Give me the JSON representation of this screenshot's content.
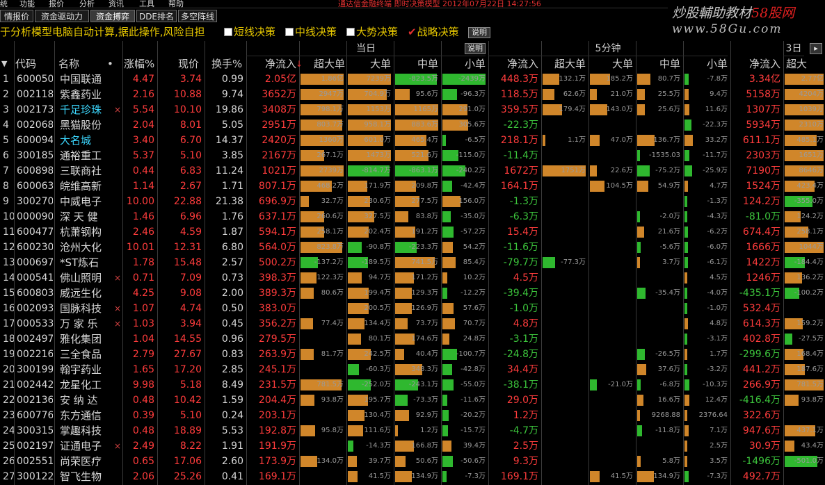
{
  "menu": {
    "items": [
      "统",
      "功能",
      "报价",
      "分析",
      "资讯",
      "工具",
      "帮助"
    ],
    "title": "通达信金融终端   即时决策模型 2012年07月22日 14:27:56"
  },
  "tabs": [
    {
      "label": "情报价",
      "active": false
    },
    {
      "label": "资金驱动力",
      "active": false
    },
    {
      "label": "资金搏弈",
      "active": true
    },
    {
      "label": "DDE排名",
      "active": false
    },
    {
      "label": "多空阵线",
      "active": false
    }
  ],
  "logo": {
    "line1_a": "炒股輔助教材",
    "line1_b": "58股网",
    "line2": "www.58Gu.com"
  },
  "description": "于分析模型电脑自动计算,据此操作,风险自担",
  "decisions": [
    {
      "label": "短线决策",
      "checked": false
    },
    {
      "label": "中线决策",
      "checked": false
    },
    {
      "label": "大势决策",
      "checked": false
    },
    {
      "label": "战略决策",
      "checked": true
    }
  ],
  "explain_label": "说明",
  "groups": {
    "today": "当日",
    "five_min": "5分钟",
    "three_day": "3日",
    "explain": "说明"
  },
  "columns": {
    "code": "代码",
    "name": "名称",
    "dot": "•",
    "change": "涨幅%",
    "price": "现价",
    "turnover": "换手%",
    "net": "净流入",
    "xl": "超大单",
    "l": "大单",
    "m": "中单",
    "s": "小单",
    "net5": "净流入",
    "xl5": "超大单",
    "l5": "大单",
    "m5": "中单",
    "s5": "小单",
    "net3": "净流入",
    "xl3": "超大"
  },
  "colors": {
    "red": "#ff3c3c",
    "green": "#3cc43c",
    "cyan": "#3cd8ff",
    "yellow": "#e6c700",
    "orange": "#d0862a",
    "greenbar": "#2fb82f"
  },
  "rows": [
    {
      "no": "1",
      "code": "600050",
      "name": "中国联通",
      "mark": "",
      "change": "4.47",
      "price": "3.74",
      "turnover": "0.99",
      "net": "2.05亿",
      "today": [
        "1.86亿",
        "7239万",
        "-823.5万",
        "-2439万"
      ],
      "net5": "448.3万",
      "five": [
        "132.1万",
        "185.2万",
        "80.7万",
        "-7.8万"
      ],
      "net3": "3.34亿",
      "d3": "2.77亿"
    },
    {
      "no": "2",
      "code": "002118",
      "name": "紫鑫药业",
      "mark": "",
      "change": "2.16",
      "price": "10.88",
      "turnover": "9.74",
      "net": "3652万",
      "today": [
        "2947万",
        "704.9万",
        "95.6万",
        "-96.3万"
      ],
      "net5": "118.5万",
      "five": [
        "62.6万",
        "21.0万",
        "25.5万",
        "9.4万"
      ],
      "net3": "5158万",
      "d3": "4204万"
    },
    {
      "no": "3",
      "code": "002173",
      "name": "千足珍珠",
      "mark": "×",
      "change": "5.54",
      "price": "10.10",
      "turnover": "19.86",
      "net": "3408万",
      "today": [
        "798.1万",
        "1153万",
        "1165万",
        "291.0万"
      ],
      "net5": "359.5万",
      "five": [
        "179.4万",
        "143.0万",
        "25.6万",
        "11.6万"
      ],
      "net3": "1307万",
      "d3": "1039万"
    },
    {
      "no": "4",
      "code": "002068",
      "name": "黑猫股份",
      "mark": "",
      "change": "2.04",
      "price": "8.01",
      "turnover": "5.05",
      "net": "2951万",
      "today": [
        "803.7万",
        "958.1万",
        "883.6万",
        "305.6万"
      ],
      "net5": "-22.3万",
      "five": [
        "",
        "",
        "",
        "-22.3万"
      ],
      "net3": "5934万",
      "d3": "2310万"
    },
    {
      "no": "5",
      "code": "600094",
      "name": "大名城",
      "mark": "",
      "change": "3.40",
      "price": "6.70",
      "turnover": "14.37",
      "net": "2420万",
      "today": [
        "1360万",
        "601.0万",
        "465.4万",
        "-6.5万"
      ],
      "net5": "218.1万",
      "five": [
        "1.1万",
        "47.0万",
        "136.7万",
        "33.2万"
      ],
      "net3": "611.1万",
      "d3": "485.1万"
    },
    {
      "no": "6",
      "code": "300185",
      "name": "通裕重工",
      "mark": "",
      "change": "5.37",
      "price": "5.10",
      "turnover": "3.85",
      "net": "2167万",
      "today": [
        "267.1万",
        "1473万",
        "521.6万",
        "-115.0万"
      ],
      "net5": "-11.4万",
      "five": [
        "",
        "",
        "-1535.03",
        "-11.7万"
      ],
      "net3": "2303万",
      "d3": "1651万"
    },
    {
      "no": "7",
      "code": "600898",
      "name": "三联商社",
      "mark": "",
      "change": "0.44",
      "price": "6.83",
      "turnover": "11.24",
      "net": "1021万",
      "today": [
        "2739万",
        "-814.7万",
        "-863.1万",
        "-240.2万"
      ],
      "net5": "1672万",
      "five": [
        "1751万",
        "22.6万",
        "-75.2万",
        "-25.9万"
      ],
      "net3": "7190万",
      "d3": "8646万"
    },
    {
      "no": "8",
      "code": "600063",
      "name": "皖维高新",
      "mark": "",
      "change": "1.14",
      "price": "2.67",
      "turnover": "1.71",
      "net": "807.1万",
      "today": [
        "468.2万",
        "171.9万",
        "209.8万",
        "-42.4万"
      ],
      "net5": "164.1万",
      "five": [
        "",
        "104.5万",
        "54.9万",
        "4.7万"
      ],
      "net3": "1524万",
      "d3": "423.4万"
    },
    {
      "no": "9",
      "code": "300270",
      "name": "中威电子",
      "mark": "",
      "change": "10.00",
      "price": "22.88",
      "turnover": "21.38",
      "net": "696.9万",
      "today": [
        "32.7万",
        "230.6万",
        "277.5万",
        "156.0万"
      ],
      "net5": "-1.3万",
      "five": [
        "",
        "",
        "",
        "-1.3万"
      ],
      "net3": "124.2万",
      "d3": "-355.0万"
    },
    {
      "no": "10",
      "code": "000090",
      "name": "深 天 健",
      "mark": "",
      "change": "1.46",
      "price": "6.96",
      "turnover": "1.76",
      "net": "637.1万",
      "today": [
        "260.6万",
        "327.5万",
        "83.8万",
        "-35.0万"
      ],
      "net5": "-6.3万",
      "five": [
        "",
        "",
        "-2.0万",
        "-4.3万"
      ],
      "net3": "-81.0万",
      "d3": "124.2万"
    },
    {
      "no": "11",
      "code": "600477",
      "name": "杭萧钢构",
      "mark": "",
      "change": "2.46",
      "price": "4.59",
      "turnover": "1.87",
      "net": "594.1万",
      "today": [
        "258.1万",
        "202.4万",
        "191.2万",
        "-57.2万"
      ],
      "net5": "15.4万",
      "five": [
        "",
        "",
        "21.6万",
        "-6.2万"
      ],
      "net3": "674.4万",
      "d3": "258.1万"
    },
    {
      "no": "12",
      "code": "600230",
      "name": "沧州大化",
      "mark": "",
      "change": "10.01",
      "price": "12.31",
      "turnover": "6.80",
      "net": "564.0万",
      "today": [
        "823.8万",
        "-90.8万",
        "-223.3万",
        "54.2万"
      ],
      "net5": "-11.6万",
      "five": [
        "",
        "",
        "-5.6万",
        "-6.0万"
      ],
      "net3": "1666万",
      "d3": "1044万"
    },
    {
      "no": "13",
      "code": "000697",
      "name": "*ST炼石",
      "mark": "",
      "change": "1.78",
      "price": "15.48",
      "turnover": "2.57",
      "net": "500.2万",
      "today": [
        "-137.2万",
        "-189.5万",
        "741.5万",
        "85.4万"
      ],
      "net5": "-79.7万",
      "five": [
        "-77.3万",
        "",
        "3.7万",
        "-6.1万"
      ],
      "net3": "1422万",
      "d3": "-184.4万"
    },
    {
      "no": "14",
      "code": "000541",
      "name": "佛山照明",
      "mark": "×",
      "change": "0.71",
      "price": "7.09",
      "turnover": "0.73",
      "net": "398.3万",
      "today": [
        "122.3万",
        "94.7万",
        "171.2万",
        "10.2万"
      ],
      "net5": "4.5万",
      "five": [
        "",
        "",
        "",
        "4.5万"
      ],
      "net3": "1246万",
      "d3": "136.2万"
    },
    {
      "no": "15",
      "code": "600803",
      "name": "威远生化",
      "mark": "",
      "change": "4.25",
      "price": "9.08",
      "turnover": "2.00",
      "net": "389.3万",
      "today": [
        "80.6万",
        "199.4万",
        "129.3万",
        "-12.2万"
      ],
      "net5": "-39.4万",
      "five": [
        "",
        "",
        "-35.4万",
        "-4.0万"
      ],
      "net3": "-435.1万",
      "d3": "-100.2万"
    },
    {
      "no": "16",
      "code": "002093",
      "name": "国脉科技",
      "mark": "×",
      "change": "1.07",
      "price": "4.74",
      "turnover": "0.50",
      "net": "383.0万",
      "today": [
        "",
        "200.5万",
        "126.9万",
        "57.6万"
      ],
      "net5": "-1.0万",
      "five": [
        "",
        "",
        "",
        "-1.0万"
      ],
      "net3": "532.4万",
      "d3": ""
    },
    {
      "no": "17",
      "code": "000533",
      "name": "万 家 乐",
      "mark": "×",
      "change": "1.03",
      "price": "3.94",
      "turnover": "0.45",
      "net": "356.2万",
      "today": [
        "77.4万",
        "134.4万",
        "73.7万",
        "70.7万"
      ],
      "net5": "4.8万",
      "five": [
        "",
        "",
        "",
        "4.8万"
      ],
      "net3": "614.3万",
      "d3": "159.2万"
    },
    {
      "no": "18",
      "code": "002497",
      "name": "雅化集团",
      "mark": "",
      "change": "1.04",
      "price": "14.55",
      "turnover": "0.96",
      "net": "279.5万",
      "today": [
        "",
        "80.1万",
        "174.6万",
        "24.8万"
      ],
      "net5": "-3.1万",
      "five": [
        "",
        "",
        "",
        "-3.1万"
      ],
      "net3": "402.8万",
      "d3": "-27.5万"
    },
    {
      "no": "19",
      "code": "002216",
      "name": "三全食品",
      "mark": "",
      "change": "2.79",
      "price": "27.67",
      "turnover": "0.83",
      "net": "263.9万",
      "today": [
        "81.7万",
        "242.5万",
        "40.4万",
        "-100.7万"
      ],
      "net5": "-24.8万",
      "five": [
        "",
        "",
        "-26.5万",
        "1.7万"
      ],
      "net3": "-299.6万",
      "d3": "168.4万"
    },
    {
      "no": "20",
      "code": "300199",
      "name": "翰宇药业",
      "mark": "",
      "change": "1.65",
      "price": "17.20",
      "turnover": "2.85",
      "net": "245.1万",
      "today": [
        "",
        "-60.3万",
        "348.3万",
        "-42.8万"
      ],
      "net5": "34.4万",
      "five": [
        "",
        "",
        "37.6万",
        "-3.2万"
      ],
      "net3": "441.2万",
      "d3": "187.6万"
    },
    {
      "no": "21",
      "code": "002442",
      "name": "龙星化工",
      "mark": "",
      "change": "9.98",
      "price": "5.18",
      "turnover": "8.49",
      "net": "231.5万",
      "today": [
        "781.5万",
        "-252.0万",
        "-243.1万",
        "-55.0万"
      ],
      "net5": "-38.1万",
      "five": [
        "",
        "-21.0万",
        "-6.8万",
        "-10.3万"
      ],
      "net3": "266.9万",
      "d3": "781.5万"
    },
    {
      "no": "22",
      "code": "002136",
      "name": "安 纳 达",
      "mark": "",
      "change": "0.48",
      "price": "10.42",
      "turnover": "1.59",
      "net": "204.4万",
      "today": [
        "93.8万",
        "195.7万",
        "-73.3万",
        "-11.6万"
      ],
      "net5": "29.0万",
      "five": [
        "",
        "",
        "16.6万",
        "12.4万"
      ],
      "net3": "-416.4万",
      "d3": "93.8万"
    },
    {
      "no": "23",
      "code": "600776",
      "name": "东方通信",
      "mark": "",
      "change": "0.39",
      "price": "5.10",
      "turnover": "0.24",
      "net": "203.1万",
      "today": [
        "",
        "130.4万",
        "92.9万",
        "-20.2万"
      ],
      "net5": "1.2万",
      "five": [
        "",
        "",
        "9268.88",
        "2376.64"
      ],
      "net3": "322.6万",
      "d3": ""
    },
    {
      "no": "24",
      "code": "300315",
      "name": "掌趣科技",
      "mark": "",
      "change": "0.48",
      "price": "18.89",
      "turnover": "5.53",
      "net": "192.8万",
      "today": [
        "95.8万",
        "111.6万",
        "1.2万",
        "-15.7万"
      ],
      "net5": "-4.7万",
      "five": [
        "",
        "",
        "-11.8万",
        "7.1万"
      ],
      "net3": "947.6万",
      "d3": "437.1万"
    },
    {
      "no": "25",
      "code": "002197",
      "name": "证通电子",
      "mark": "×",
      "change": "2.49",
      "price": "8.22",
      "turnover": "1.91",
      "net": "191.9万",
      "today": [
        "",
        "-14.3万",
        "166.8万",
        "39.4万"
      ],
      "net5": "2.5万",
      "five": [
        "",
        "",
        "",
        "2.5万"
      ],
      "net3": "30.9万",
      "d3": "43.4万"
    },
    {
      "no": "26",
      "code": "002551",
      "name": "尚荣医疗",
      "mark": "",
      "change": "0.65",
      "price": "17.06",
      "turnover": "2.60",
      "net": "173.9万",
      "today": [
        "134.0万",
        "39.7万",
        "50.6万",
        "-50.6万"
      ],
      "net5": "9.3万",
      "five": [
        "",
        "",
        "5.8万",
        "3.5万"
      ],
      "net3": "-1496万",
      "d3": "-501.0万"
    },
    {
      "no": "27",
      "code": "300122",
      "name": "智飞生物",
      "mark": "",
      "change": "2.06",
      "price": "25.26",
      "turnover": "0.41",
      "net": "169.1万",
      "today": [
        "",
        "41.5万",
        "134.9万",
        "-7.3万"
      ],
      "net5": "169.1万",
      "five": [
        "",
        "41.5万",
        "134.9万",
        "-7.3万"
      ],
      "net3": "492.7万",
      "d3": ""
    }
  ]
}
